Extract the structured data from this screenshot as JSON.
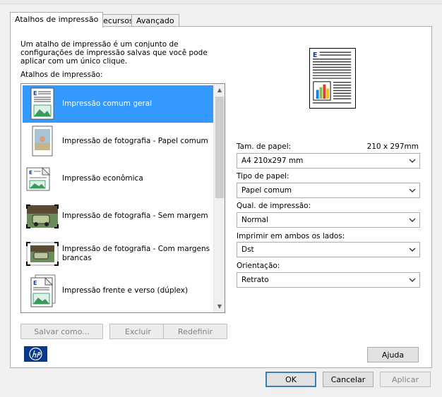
{
  "tabs": [
    {
      "label": "Atalhos de impressão",
      "active": true
    },
    {
      "label": "Recursos",
      "active": false
    },
    {
      "label": "Avançado",
      "active": false
    }
  ],
  "shortcuts": {
    "description": "Um atalho de impressão é um conjunto de configurações de impressão salvas que você pode aplicar com um único clique.",
    "list_label": "Atalhos de impressão:",
    "items": [
      {
        "label": "Impressão comum geral",
        "icon": "document-icon",
        "selected": true
      },
      {
        "label": "Impressão de fotografia - Papel comum",
        "icon": "photo-plain-paper-icon",
        "selected": false
      },
      {
        "label": "Impressão econômica",
        "icon": "economy-document-icon",
        "selected": false
      },
      {
        "label": "Impressão de fotografia - Sem margem",
        "icon": "borderless-photo-icon",
        "selected": false
      },
      {
        "label": "Impressão de fotografia - Com margens brancas",
        "icon": "white-borders-photo-icon",
        "selected": false
      },
      {
        "label": "Impressão frente e verso (dúplex)",
        "icon": "duplex-document-icon",
        "selected": false
      }
    ],
    "buttons": {
      "save_as": "Salvar como...",
      "delete": "Excluir",
      "reset": "Redefinir"
    }
  },
  "settings": {
    "paper_size_label": "Tam. de papel:",
    "paper_size_dims": "210 x 297mm",
    "paper_size_value": "A4 210x297 mm",
    "paper_type_label": "Tipo de papel:",
    "paper_type_value": "Papel comum",
    "quality_label": "Qual. de impressão:",
    "quality_value": "Normal",
    "duplex_label": "Imprimir em ambos os lados:",
    "duplex_value": "Dst",
    "orientation_label": "Orientação:",
    "orientation_value": "Retrato"
  },
  "help_button": "Ajuda",
  "dialog_buttons": {
    "ok": "OK",
    "cancel": "Cancelar",
    "apply": "Aplicar"
  },
  "colors": {
    "selection": "#3399ff",
    "accent_border": "#3c7fb1"
  }
}
